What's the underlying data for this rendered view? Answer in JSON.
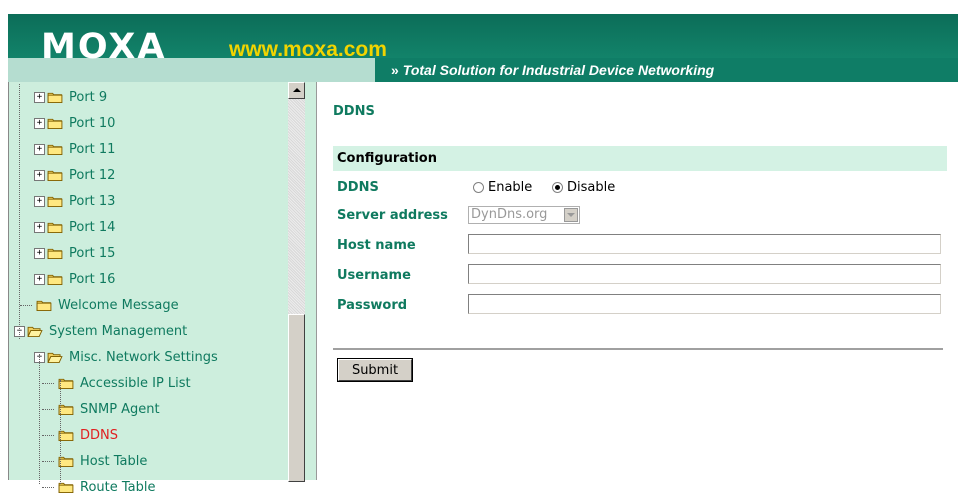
{
  "header": {
    "logo": "MOXA",
    "url": "www.moxa.com",
    "tagline": "Total Solution for Industrial Device Networking",
    "tagline_arrow": "»"
  },
  "sidebar": {
    "items": [
      {
        "label": "Port 9"
      },
      {
        "label": "Port 10"
      },
      {
        "label": "Port 11"
      },
      {
        "label": "Port 12"
      },
      {
        "label": "Port 13"
      },
      {
        "label": "Port 14"
      },
      {
        "label": "Port 15"
      },
      {
        "label": "Port 16"
      },
      {
        "label": "Welcome Message"
      },
      {
        "label": "System Management"
      },
      {
        "label": "Misc. Network Settings"
      },
      {
        "label": "Accessible IP List"
      },
      {
        "label": "SNMP Agent"
      },
      {
        "label": "DDNS"
      },
      {
        "label": "Host Table"
      },
      {
        "label": "Route Table"
      }
    ]
  },
  "page": {
    "title": "DDNS",
    "section": "Configuration",
    "fields": {
      "ddns_label": "DDNS",
      "enable_label": "Enable",
      "disable_label": "Disable",
      "selected": "Disable",
      "server_label": "Server address",
      "server_value": "DynDns.org",
      "host_label": "Host name",
      "host_value": "",
      "user_label": "Username",
      "user_value": "",
      "pass_label": "Password",
      "pass_value": ""
    },
    "submit": "Submit"
  },
  "colors": {
    "brand_green": "#0f7d66",
    "link_green": "#0f7a5f",
    "selected_red": "#e02020",
    "url_yellow": "#f2d400",
    "sidebar_bg": "#cdeedd"
  }
}
